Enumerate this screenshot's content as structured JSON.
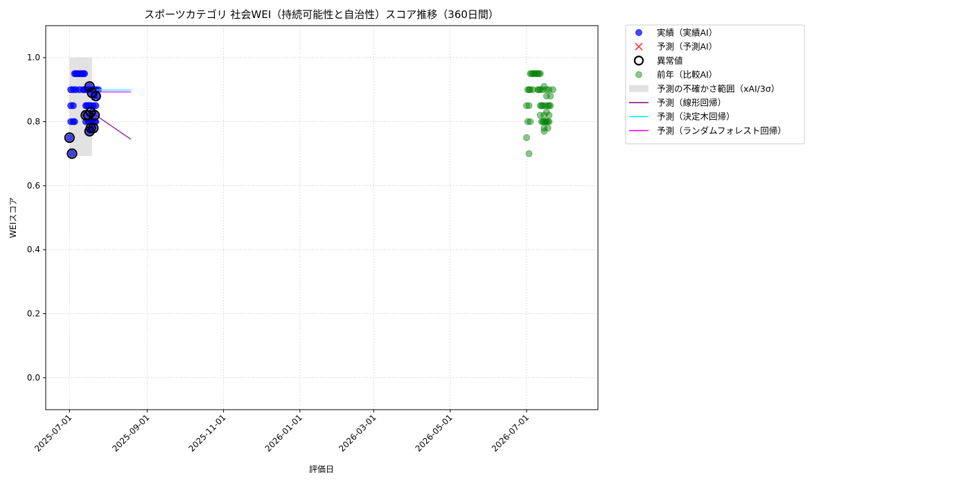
{
  "chart_data": {
    "type": "scatter",
    "title": "スポーツカテゴリ 社会WEI（持続可能性と自治性）スコア推移（360日間）",
    "xlabel": "評価日",
    "ylabel": "WEIスコア",
    "ylim": [
      -0.1,
      1.1
    ],
    "xlim": [
      "2025-06-12",
      "2026-08-27"
    ],
    "grid": true,
    "legend_placement": "outside-top-right",
    "x_ticks": [
      "2025-07-01",
      "2025-09-01",
      "2025-11-01",
      "2026-01-01",
      "2026-03-01",
      "2026-05-01",
      "2026-07-01"
    ],
    "y_ticks": [
      0.0,
      0.2,
      0.4,
      0.6,
      0.8,
      1.0
    ],
    "legend": [
      {
        "key": "actual",
        "label": "実績（実績AI）",
        "color": "#0000ff",
        "marker": "circle"
      },
      {
        "key": "predicted",
        "label": "予測（予測AI）",
        "color": "#ff0000",
        "marker": "x"
      },
      {
        "key": "anomaly",
        "label": "異常値",
        "color": "#000000",
        "marker": "ring"
      },
      {
        "key": "prev_year",
        "label": "前年（比較AI）",
        "color": "#008000",
        "marker": "circle"
      },
      {
        "key": "uncertainty",
        "label": "予測の不確かさ範囲（xAI/3σ）",
        "color": "#bfbfbf",
        "marker": "band"
      },
      {
        "key": "linear",
        "label": "予測（線形回帰）",
        "color": "#800080",
        "marker": "line"
      },
      {
        "key": "tree",
        "label": "予測（決定木回帰）",
        "color": "#00ffff",
        "marker": "line"
      },
      {
        "key": "forest",
        "label": "予測（ランダムフォレスト回帰）",
        "color": "#ff00ff",
        "marker": "line"
      }
    ],
    "series": [
      {
        "key": "actual",
        "points": [
          [
            "2025-07-01",
            0.75
          ],
          [
            "2025-07-02",
            0.85
          ],
          [
            "2025-07-02",
            0.8
          ],
          [
            "2025-07-02",
            0.9
          ],
          [
            "2025-07-03",
            0.7
          ],
          [
            "2025-07-04",
            0.9
          ],
          [
            "2025-07-04",
            0.85
          ],
          [
            "2025-07-04",
            0.8
          ],
          [
            "2025-07-05",
            0.95
          ],
          [
            "2025-07-05",
            0.8
          ],
          [
            "2025-07-06",
            0.95
          ],
          [
            "2025-07-06",
            0.9
          ],
          [
            "2025-07-07",
            0.95
          ],
          [
            "2025-07-08",
            0.95
          ],
          [
            "2025-07-09",
            0.9
          ],
          [
            "2025-07-09",
            0.95
          ],
          [
            "2025-07-10",
            0.95
          ],
          [
            "2025-07-11",
            0.95
          ],
          [
            "2025-07-12",
            0.9
          ],
          [
            "2025-07-12",
            0.95
          ],
          [
            "2025-07-13",
            0.9
          ],
          [
            "2025-07-13",
            0.95
          ],
          [
            "2025-07-14",
            0.85
          ],
          [
            "2025-07-14",
            0.82
          ],
          [
            "2025-07-14",
            0.8
          ],
          [
            "2025-07-15",
            0.9
          ],
          [
            "2025-07-15",
            0.85
          ],
          [
            "2025-07-16",
            0.8
          ],
          [
            "2025-07-16",
            0.85
          ],
          [
            "2025-07-17",
            0.77
          ],
          [
            "2025-07-17",
            0.9
          ],
          [
            "2025-07-17",
            0.85
          ],
          [
            "2025-07-17",
            0.8
          ],
          [
            "2025-07-17",
            0.91
          ],
          [
            "2025-07-18",
            0.82
          ],
          [
            "2025-07-18",
            0.78
          ],
          [
            "2025-07-18",
            0.85
          ],
          [
            "2025-07-19",
            0.89
          ],
          [
            "2025-07-19",
            0.83
          ],
          [
            "2025-07-19",
            0.8
          ],
          [
            "2025-07-20",
            0.9
          ],
          [
            "2025-07-20",
            0.85
          ],
          [
            "2025-07-20",
            0.78
          ],
          [
            "2025-07-21",
            0.82
          ],
          [
            "2025-07-21",
            0.88
          ],
          [
            "2025-07-21",
            0.8
          ],
          [
            "2025-07-22",
            0.9
          ],
          [
            "2025-07-22",
            0.85
          ],
          [
            "2025-07-22",
            0.8
          ],
          [
            "2025-07-23",
            0.88
          ],
          [
            "2025-07-24",
            0.9
          ]
        ]
      },
      {
        "key": "anomaly",
        "points": [
          [
            "2025-07-01",
            0.75
          ],
          [
            "2025-07-03",
            0.7
          ],
          [
            "2025-07-14",
            0.82
          ],
          [
            "2025-07-16",
            0.82
          ],
          [
            "2025-07-17",
            0.91
          ],
          [
            "2025-07-17",
            0.77
          ],
          [
            "2025-07-18",
            0.78
          ],
          [
            "2025-07-18",
            0.83
          ],
          [
            "2025-07-19",
            0.89
          ],
          [
            "2025-07-20",
            0.78
          ],
          [
            "2025-07-21",
            0.82
          ],
          [
            "2025-07-22",
            0.88
          ]
        ]
      },
      {
        "key": "prev_year",
        "points": [
          [
            "2026-07-01",
            0.75
          ],
          [
            "2026-07-01",
            0.85
          ],
          [
            "2026-07-02",
            0.8
          ],
          [
            "2026-07-02",
            0.9
          ],
          [
            "2026-07-03",
            0.7
          ],
          [
            "2026-07-03",
            0.85
          ],
          [
            "2026-07-03",
            0.9
          ],
          [
            "2026-07-04",
            0.8
          ],
          [
            "2026-07-04",
            0.95
          ],
          [
            "2026-07-04",
            0.9
          ],
          [
            "2026-07-05",
            0.95
          ],
          [
            "2026-07-06",
            0.95
          ],
          [
            "2026-07-06",
            0.9
          ],
          [
            "2026-07-07",
            0.95
          ],
          [
            "2026-07-08",
            0.95
          ],
          [
            "2026-07-09",
            0.95
          ],
          [
            "2026-07-10",
            0.95
          ],
          [
            "2026-07-10",
            0.9
          ],
          [
            "2026-07-11",
            0.95
          ],
          [
            "2026-07-11",
            0.9
          ],
          [
            "2026-07-12",
            0.95
          ],
          [
            "2026-07-12",
            0.85
          ],
          [
            "2026-07-12",
            0.82
          ],
          [
            "2026-07-12",
            0.9
          ],
          [
            "2026-07-13",
            0.8
          ],
          [
            "2026-07-13",
            0.85
          ],
          [
            "2026-07-14",
            0.9
          ],
          [
            "2026-07-14",
            0.8
          ],
          [
            "2026-07-14",
            0.85
          ],
          [
            "2026-07-15",
            0.91
          ],
          [
            "2026-07-15",
            0.8
          ],
          [
            "2026-07-15",
            0.82
          ],
          [
            "2026-07-15",
            0.78
          ],
          [
            "2026-07-15",
            0.77
          ],
          [
            "2026-07-16",
            0.85
          ],
          [
            "2026-07-16",
            0.8
          ],
          [
            "2026-07-17",
            0.9
          ],
          [
            "2026-07-17",
            0.88
          ],
          [
            "2026-07-17",
            0.83
          ],
          [
            "2026-07-17",
            0.8
          ],
          [
            "2026-07-18",
            0.85
          ],
          [
            "2026-07-18",
            0.8
          ],
          [
            "2026-07-18",
            0.78
          ],
          [
            "2026-07-19",
            0.9
          ],
          [
            "2026-07-19",
            0.85
          ],
          [
            "2026-07-19",
            0.82
          ],
          [
            "2026-07-19",
            0.8
          ],
          [
            "2026-07-20",
            0.88
          ],
          [
            "2026-07-20",
            0.85
          ],
          [
            "2026-07-22",
            0.9
          ]
        ]
      },
      {
        "key": "uncertainty",
        "x_range": [
          "2025-07-01",
          "2025-07-19"
        ],
        "y_range": [
          0.693,
          1.0
        ]
      },
      {
        "key": "linear",
        "points": [
          [
            "2025-07-19",
            0.828
          ],
          [
            "2025-08-19",
            0.745
          ]
        ]
      },
      {
        "key": "tree",
        "points": [
          [
            "2025-07-19",
            0.899
          ],
          [
            "2025-08-19",
            0.899
          ]
        ]
      },
      {
        "key": "forest",
        "points": [
          [
            "2025-07-19",
            0.893
          ],
          [
            "2025-08-19",
            0.893
          ]
        ]
      }
    ]
  }
}
